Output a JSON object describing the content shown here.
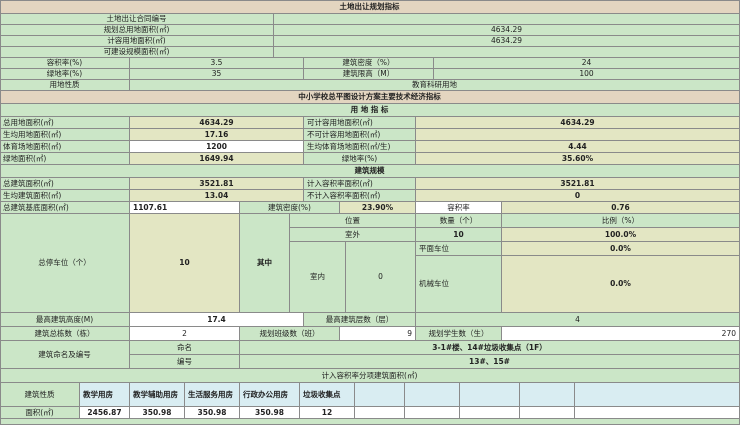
{
  "land": {
    "title": "土地出让规划指标",
    "contract_label": "土地出让合同编号",
    "planned_area_label": "规划总用地面积(㎡)",
    "planned_area_value": "4634.29",
    "plot_area_label": "计容用地面积(㎡)",
    "plot_area_value": "4634.29",
    "buildable_label": "可建设规模面积(㎡)",
    "far_label": "容积率(%)",
    "far_value": "3.5",
    "density_label": "建筑密度（%）",
    "density_value": "24",
    "green_label": "绿地率(%)",
    "green_value": "35",
    "height_label": "建筑限高（M）",
    "height_value": "100",
    "use_label": "用地性质",
    "use_value": "教育科研用地"
  },
  "econ": {
    "title": "中小学校总平图设计方案主要技术经济指标",
    "land_header": "用 地 指 标",
    "total_land_label": "总用地面积(㎡)",
    "total_land_value": "4634.29",
    "plot_land_label": "可计容用地面积(㎡)",
    "plot_land_value": "4634.29",
    "per_student_land_label": "生均用地面积(㎡)",
    "per_student_land_value": "17.16",
    "non_plot_land_label": "不可计容用地面积(㎡)",
    "sports_label": "体育场地面积(㎡)",
    "sports_value": "1200",
    "per_student_sports_label": "生均体育场地面积(㎡/生)",
    "per_student_sports_value": "4.44",
    "green_area_label": "绿地面积(㎡)",
    "green_area_value": "1649.94",
    "green_rate_label": "绿地率(%)",
    "green_rate_value": "35.60%"
  },
  "bld": {
    "header": "建筑规模",
    "total_label": "总建筑面积(㎡)",
    "total_value": "3521.81",
    "plot_label": "计入容积率面积(㎡)",
    "plot_value": "3521.81",
    "per_student_label": "生均建筑面积(㎡)",
    "per_student_value": "13.04",
    "non_plot_label": "不计入容积率面积(㎡)",
    "non_plot_value": "0",
    "base_label": "总建筑基底面积(㎡)",
    "base_value": "1107.61",
    "density_label": "建筑密度(%)",
    "density_value": "23.90%",
    "far_label": "容积率",
    "far_value": "0.76",
    "parking_label": "总停车位（个）",
    "parking_value": "10",
    "among_label": "其中",
    "position_label": "位置",
    "count_label": "数量（个）",
    "ratio_label": "比例（%）",
    "outdoor_label": "室外",
    "outdoor_count": "10",
    "outdoor_ratio": "100.0%",
    "indoor_label": "室内",
    "indoor_count": "0",
    "flat_label": "平面车位",
    "flat_ratio": "0.0%",
    "mech_label": "机械车位",
    "mech_ratio": "0.0%",
    "max_height_label": "最高建筑高度(M)",
    "max_height_value": "17.4",
    "max_floors_label": "最高建筑层数（层）",
    "max_floors_value": "4",
    "count_bld_label": "建筑总栋数（栋）",
    "count_bld_value": "2",
    "classes_label": "规划班级数（班）",
    "classes_value": "9",
    "students_label": "规划学生数（生）",
    "students_value": "270",
    "naming_label": "建筑命名及编号",
    "name_label": "命名",
    "name_value": "3-1#楼、14#垃圾收集点（1F）",
    "code_label": "编号",
    "code_value": "13#、15#",
    "breakdown_header": "计入容积率分项建筑面积(㎡)"
  },
  "breakdown": {
    "nature_label": "建筑性质",
    "area_label": "面积(㎡)",
    "cols": [
      "教学用房",
      "教学辅助用房",
      "生活服务用房",
      "行政办公用房",
      "垃圾收集点"
    ],
    "values": [
      "2456.87",
      "350.98",
      "350.98",
      "350.98",
      "12"
    ]
  }
}
